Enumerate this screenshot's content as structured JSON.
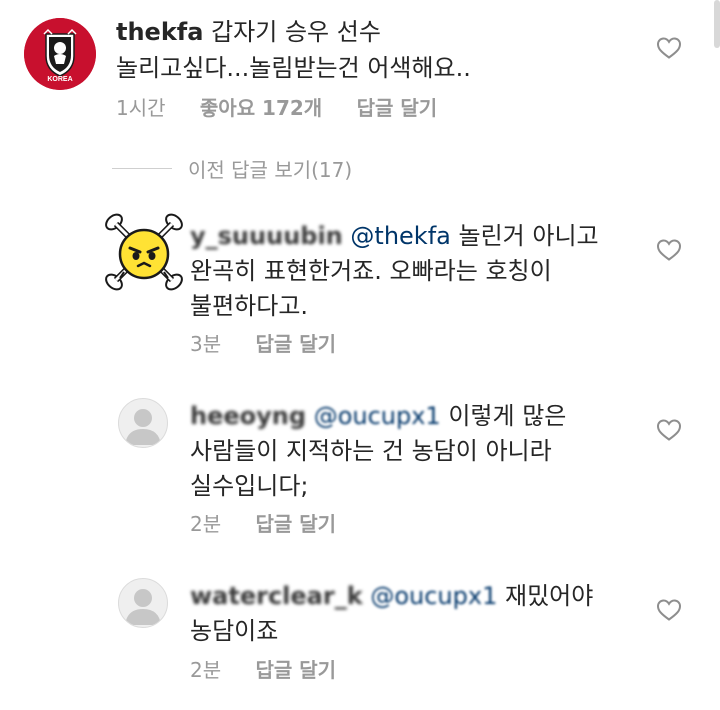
{
  "comments": [
    {
      "username": "thekfa",
      "mention": "",
      "lines": [
        "갑자기 승우 선수",
        "놀리고싶다...놀림받는건 어색해요.."
      ],
      "time": "1시간",
      "likes": "좋아요 172개",
      "reply_label": "답글 달기",
      "avatar": "kfa-logo-avatar",
      "avatar_text": "KOREA"
    },
    {
      "username": "y_suuuubin",
      "mention": "@thekfa",
      "lines": [
        "놀린거 아니고",
        "완곡히 표현한거죠. 오빠라는 호칭이",
        "불편하다고."
      ],
      "time": "3분",
      "reply_label": "답글 달기",
      "avatar": "skull-emoji-avatar"
    },
    {
      "username": "heeoyng",
      "mention": "@oucupx1",
      "lines": [
        "이렇게 많은",
        "사람들이 지적하는 건 농담이 아니라",
        "실수입니다;"
      ],
      "time": "2분",
      "reply_label": "답글 달기",
      "avatar": "default-avatar"
    },
    {
      "username": "waterclear_k",
      "mention": "@oucupx1",
      "lines": [
        "재밌어야",
        "농담이죠"
      ],
      "time": "2분",
      "reply_label": "답글 달기",
      "avatar": "default-avatar"
    }
  ],
  "view_previous": "이전 답글 보기(17)",
  "colors": {
    "mention": "#003569",
    "meta": "#999999",
    "kfa_red": "#c8102e"
  }
}
